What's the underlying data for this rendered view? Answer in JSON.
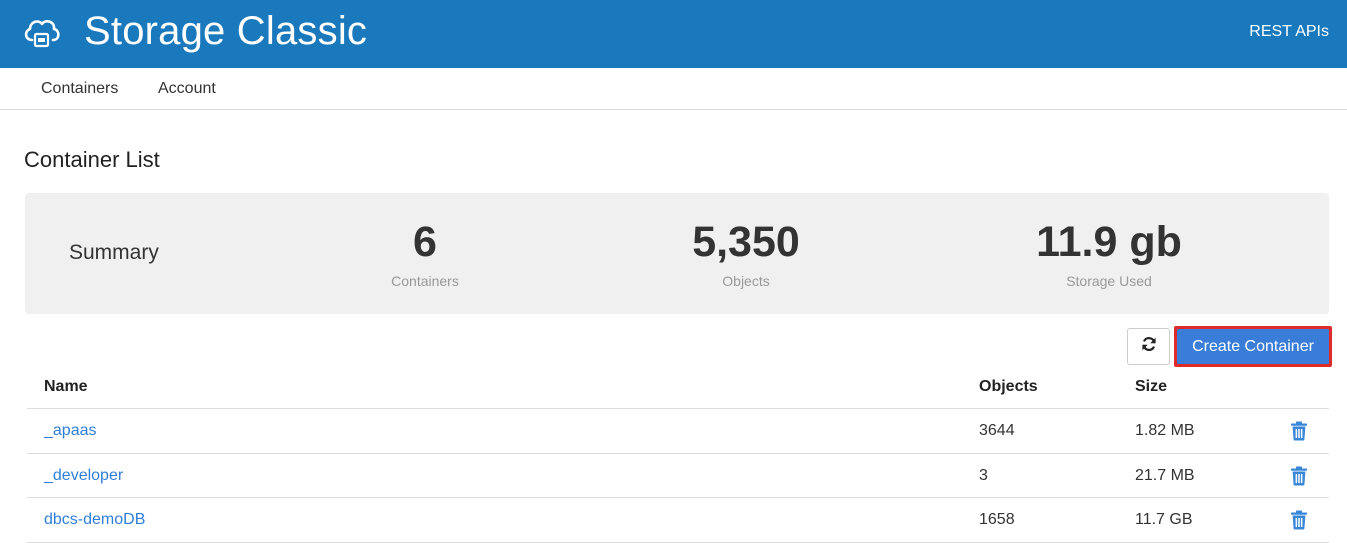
{
  "header": {
    "app_title": "Storage Classic",
    "rest_link": "REST APIs",
    "logo_icon": "cloud-storage-icon"
  },
  "nav": {
    "items": [
      {
        "label": "Containers"
      },
      {
        "label": "Account"
      }
    ]
  },
  "page": {
    "title": "Container List"
  },
  "summary": {
    "label": "Summary",
    "stats": [
      {
        "value": "6",
        "label": "Containers"
      },
      {
        "value": "5,350",
        "label": "Objects"
      },
      {
        "value": "11.9 gb",
        "label": "Storage Used"
      }
    ]
  },
  "toolbar": {
    "refresh_icon": "refresh-icon",
    "create_label": "Create Container"
  },
  "table": {
    "columns": [
      "Name",
      "Objects",
      "Size"
    ],
    "rows": [
      {
        "name": "_apaas",
        "objects": "3644",
        "size": "1.82 MB"
      },
      {
        "name": "_developer",
        "objects": "3",
        "size": "21.7 MB"
      },
      {
        "name": "dbcs-demoDB",
        "objects": "1658",
        "size": "11.7 GB"
      }
    ]
  },
  "colors": {
    "header_bg": "#1a78bd",
    "primary_button": "#3a7dd8",
    "highlight_border": "#e02b2b",
    "link": "#2f7fd8",
    "summary_bg": "#f0f0f0"
  }
}
